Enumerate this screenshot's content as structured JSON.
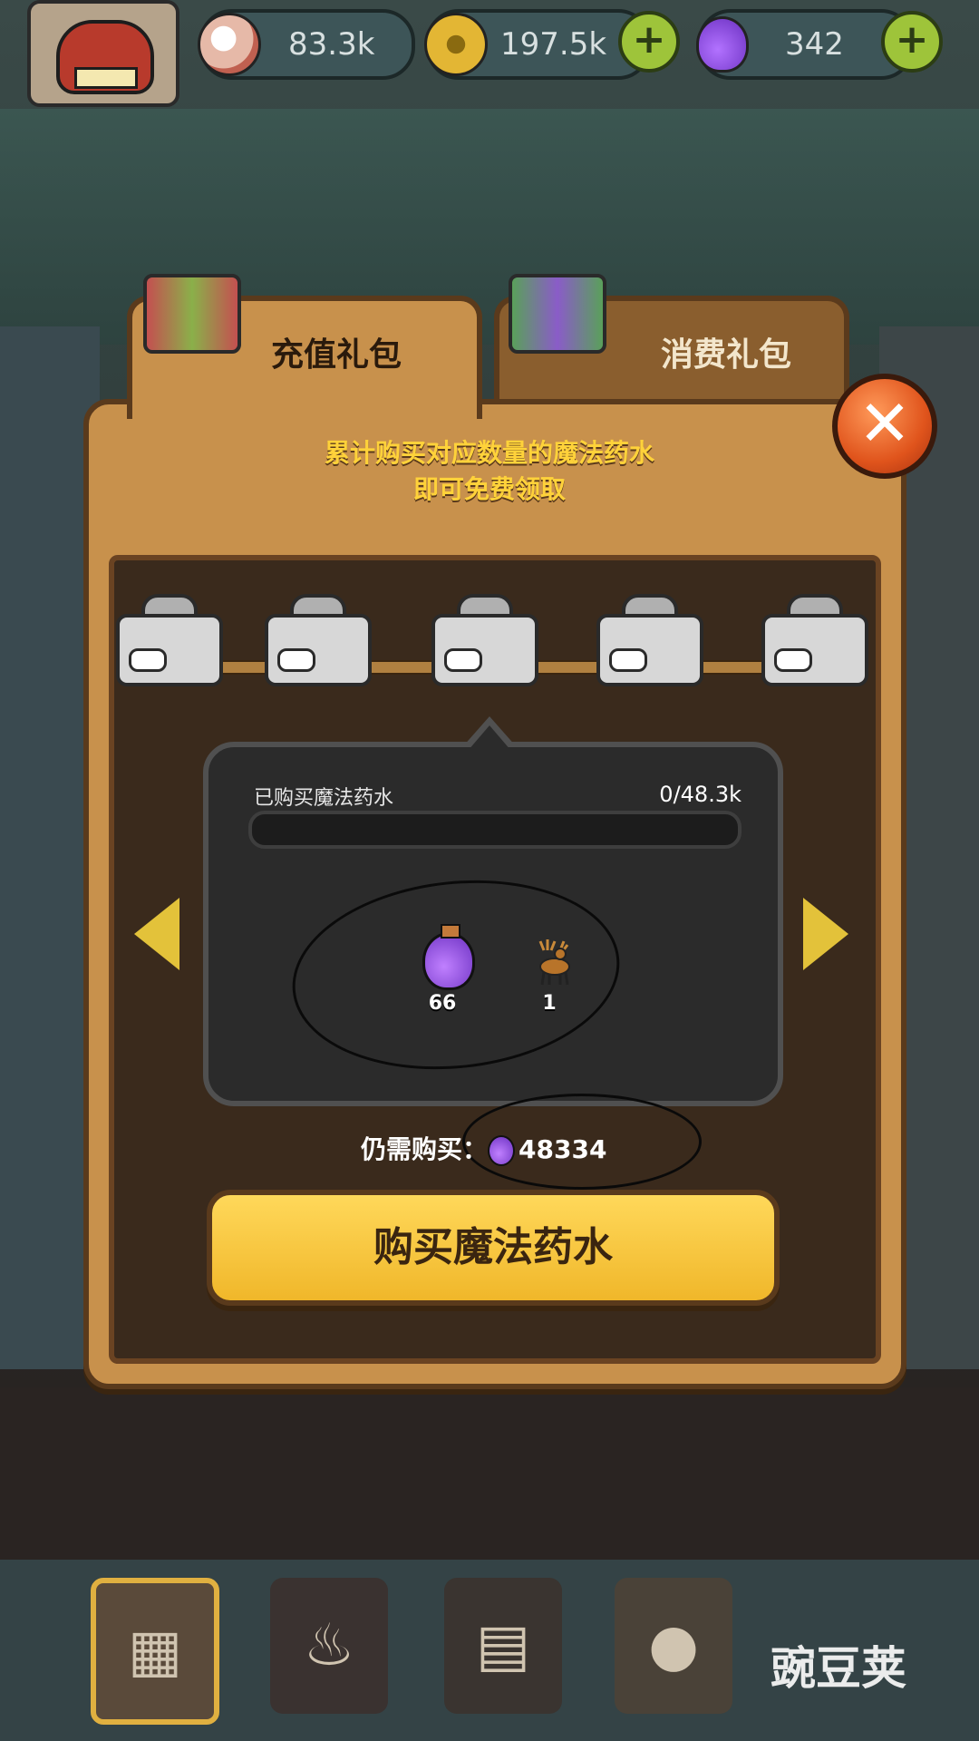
{
  "topbar": {
    "eyes_value": "83.3k",
    "coins_value": "197.5k",
    "potions_value": "342",
    "plus_label": "+"
  },
  "tabs": {
    "recharge_label": "充值礼包",
    "consume_label": "消费礼包"
  },
  "intro": {
    "line1": "累计购买对应数量的魔法药水",
    "line2": "即可免费领取"
  },
  "progress": {
    "label": "已购买魔法药水",
    "value_text": "0/48.3k",
    "fraction": 0
  },
  "rewards": [
    {
      "icon": "potion-icon",
      "qty": "66"
    },
    {
      "icon": "deer-icon",
      "qty": "1"
    }
  ],
  "remaining": {
    "label": "仍需购买：",
    "value": "48334"
  },
  "buy_button": {
    "label": "购买魔法药水"
  },
  "close_label": "✕",
  "watermark": "豌豆荚",
  "colors": {
    "panel": "#c8914c",
    "accent_yellow": "#ffd23a",
    "button": "#f0b72a",
    "progress_fill": "#9ec43a"
  }
}
